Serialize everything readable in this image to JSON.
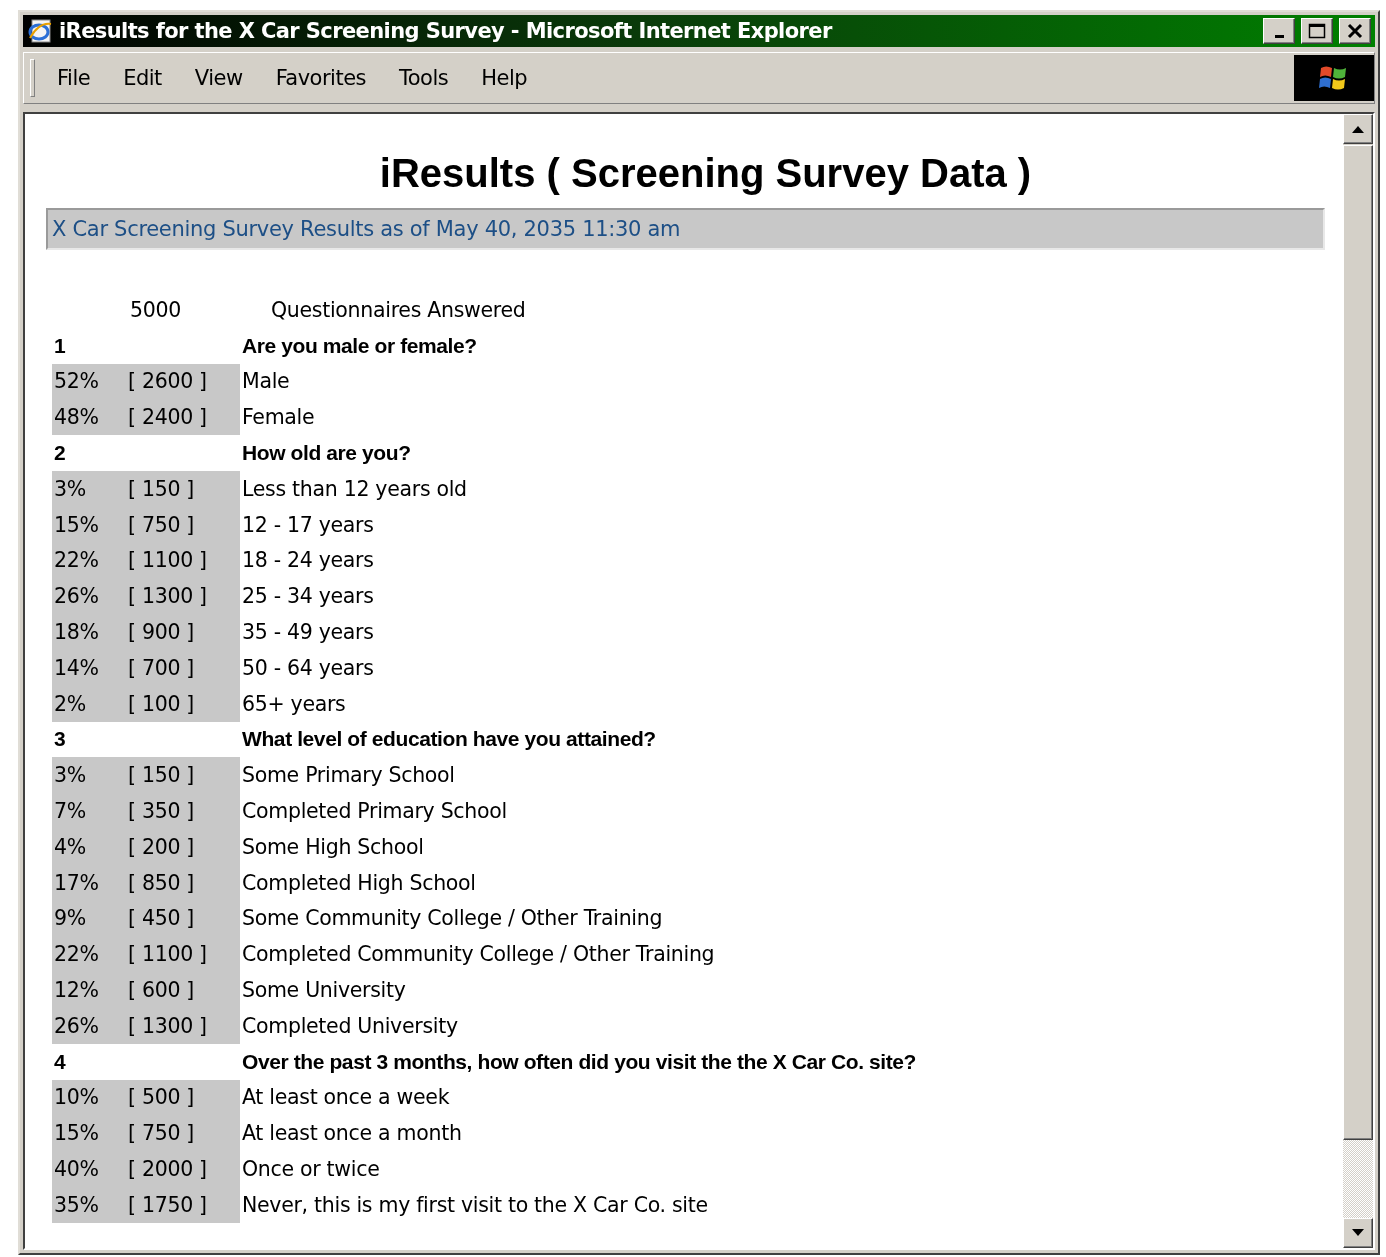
{
  "window": {
    "title": "iResults for the X Car Screening Survey - Microsoft Internet Explorer"
  },
  "menu": [
    "File",
    "Edit",
    "View",
    "Favorites",
    "Tools",
    "Help"
  ],
  "heading": "iResults ( Screening Survey Data )",
  "banner": "X Car Screening Survey Results as of May 40, 2035 11:30 am",
  "total": {
    "count": "5000",
    "label": "Questionnaires Answered"
  },
  "questions": [
    {
      "number": "1",
      "text": "Are you male or female?",
      "answers": [
        {
          "percent": "52%",
          "count": "[ 2600 ]",
          "label": "Male"
        },
        {
          "percent": "48%",
          "count": "[ 2400 ]",
          "label": "Female"
        }
      ]
    },
    {
      "number": "2",
      "text": "How old are you?",
      "answers": [
        {
          "percent": "3%",
          "count": "[ 150 ]",
          "label": "Less than 12 years old"
        },
        {
          "percent": "15%",
          "count": "[ 750 ]",
          "label": "12 - 17 years"
        },
        {
          "percent": "22%",
          "count": "[ 1100 ]",
          "label": "18 - 24 years"
        },
        {
          "percent": "26%",
          "count": "[ 1300 ]",
          "label": "25 - 34 years"
        },
        {
          "percent": "18%",
          "count": "[ 900 ]",
          "label": "35 - 49 years"
        },
        {
          "percent": "14%",
          "count": "[ 700 ]",
          "label": "50 - 64 years"
        },
        {
          "percent": "2%",
          "count": "[ 100 ]",
          "label": "65+ years"
        }
      ]
    },
    {
      "number": "3",
      "text": "What level of education have you attained?",
      "answers": [
        {
          "percent": "3%",
          "count": "[ 150 ]",
          "label": "Some Primary School"
        },
        {
          "percent": "7%",
          "count": "[ 350 ]",
          "label": "Completed Primary School"
        },
        {
          "percent": "4%",
          "count": "[ 200 ]",
          "label": "Some High School"
        },
        {
          "percent": "17%",
          "count": "[ 850 ]",
          "label": "Completed High School"
        },
        {
          "percent": "9%",
          "count": "[ 450 ]",
          "label": "Some Community College / Other Training"
        },
        {
          "percent": "22%",
          "count": "[ 1100 ]",
          "label": "Completed Community College / Other Training"
        },
        {
          "percent": "12%",
          "count": "[ 600 ]",
          "label": "Some University"
        },
        {
          "percent": "26%",
          "count": "[ 1300 ]",
          "label": "Completed University"
        }
      ]
    },
    {
      "number": "4",
      "text": "Over the past 3 months, how often did you visit the the X Car Co. site?",
      "answers": [
        {
          "percent": "10%",
          "count": "[ 500 ]",
          "label": "At least once a week"
        },
        {
          "percent": "15%",
          "count": "[ 750 ]",
          "label": "At least once a month"
        },
        {
          "percent": "40%",
          "count": "[ 2000 ]",
          "label": "Once or twice"
        },
        {
          "percent": "35%",
          "count": "[ 1750 ]",
          "label": "Never, this is my first visit to the X Car Co. site"
        }
      ]
    }
  ]
}
